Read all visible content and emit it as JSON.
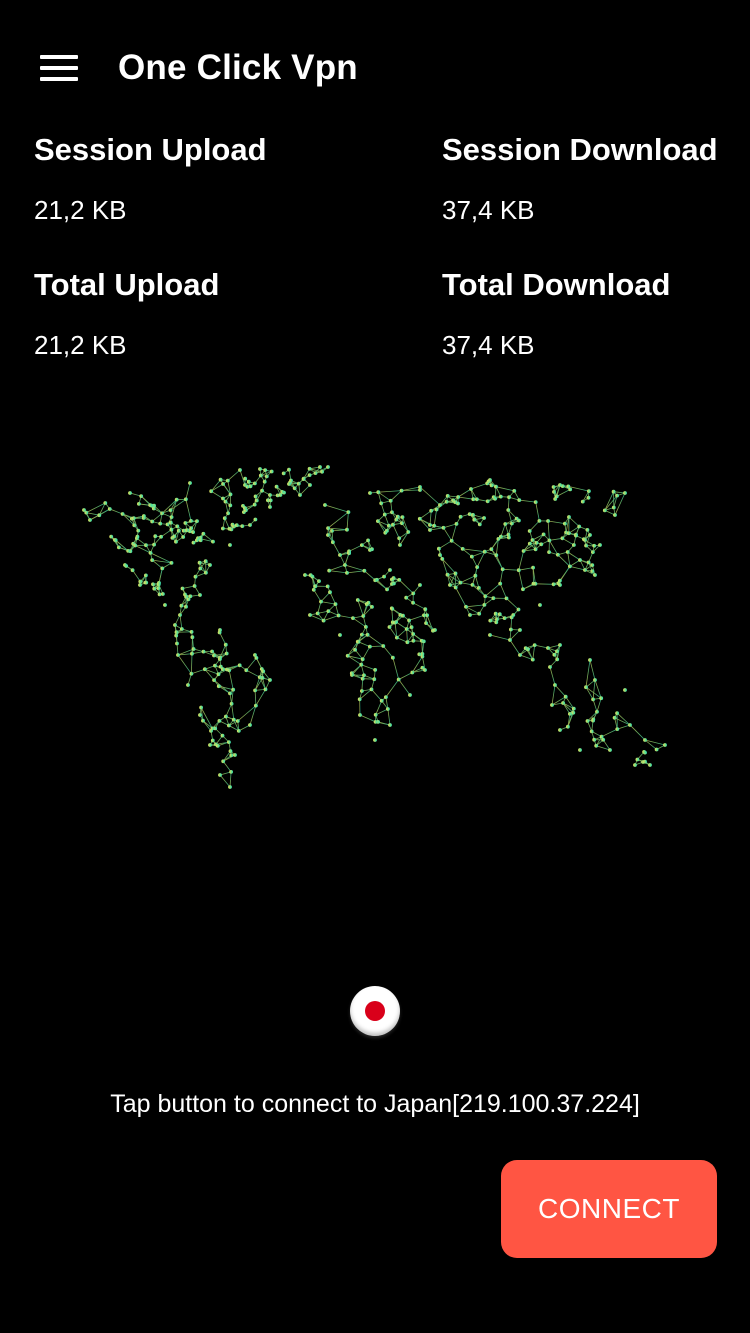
{
  "toolbar": {
    "menu_icon": "hamburger-menu-icon",
    "title": "One Click Vpn"
  },
  "stats": {
    "session_upload": {
      "label": "Session Upload",
      "value": "21,2 KB"
    },
    "session_download": {
      "label": "Session Download",
      "value": "37,4 KB"
    },
    "total_upload": {
      "label": "Total Upload",
      "value": "21,2 KB"
    },
    "total_download": {
      "label": "Total Download",
      "value": "37,4 KB"
    }
  },
  "map": {
    "icon": "world-network-map",
    "gradient": [
      "#e8e060",
      "#8ae07a",
      "#2ee0b8"
    ]
  },
  "server": {
    "flag_icon": "japan-flag-icon",
    "status_text": "Tap button to connect to Japan[219.100.37.224]"
  },
  "connect_button": {
    "label": "CONNECT",
    "color": "#ff5543"
  }
}
